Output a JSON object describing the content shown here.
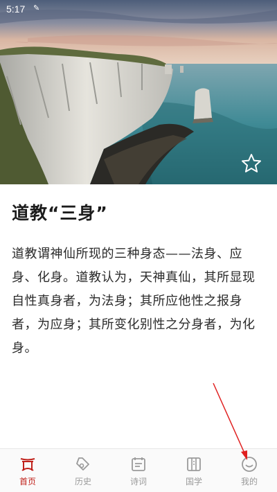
{
  "status_bar": {
    "time": "5:17",
    "notification_icon": "pen-icon"
  },
  "hero": {
    "image": "sea-cliff-photo",
    "favorite_icon": "star-outline-icon"
  },
  "article": {
    "title": "道教“三身”",
    "body": "道教谓神仙所现的三种身态——法身、应身、化身。道教认为，天神真仙，其所显现自性真身者，为法身；其所应他性之报身者，为应身；其所变化别性之分身者，为化身。"
  },
  "nav": {
    "active_color": "#c0211b",
    "items": [
      {
        "label": "首页",
        "icon": "home-gate-icon",
        "active": true
      },
      {
        "label": "历史",
        "icon": "history-icon",
        "active": false
      },
      {
        "label": "诗词",
        "icon": "poetry-icon",
        "active": false
      },
      {
        "label": "国学",
        "icon": "book-icon",
        "active": false
      },
      {
        "label": "我的",
        "icon": "smiley-icon",
        "active": false
      }
    ]
  },
  "annotation_arrow_color": "#e02020"
}
